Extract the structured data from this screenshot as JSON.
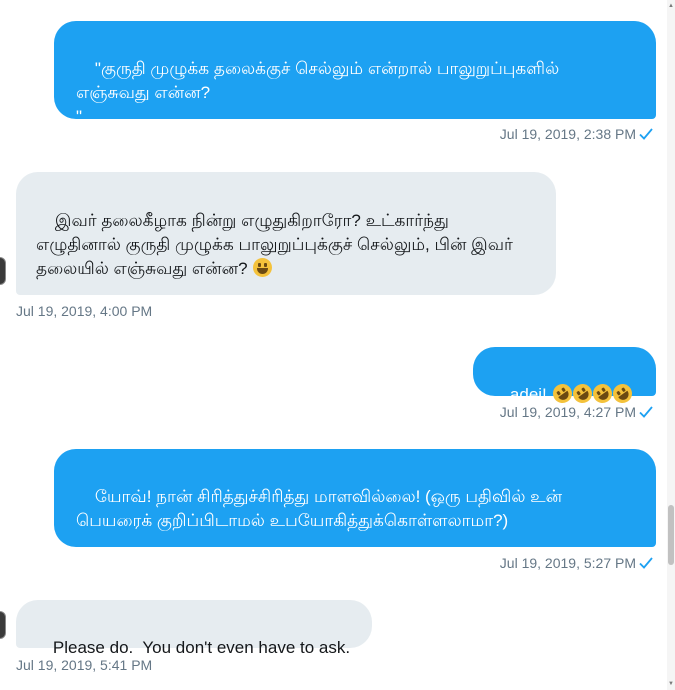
{
  "messages": [
    {
      "direction": "sent",
      "text": "\"குருதி முழுக்க தலைக்குச் செல்லும் என்றால் பாலுறுப்புகளில் எஞ்சுவது என்ன?\n\"",
      "timestamp": "Jul 19, 2019, 2:38 PM"
    },
    {
      "direction": "received",
      "text": "இவர் தலைகீழாக நின்று எழுதுகிறாரோ? உட்கார்ந்து எழுதினால் குருதி முழுக்க பாலுறுப்புக்குச் செல்லும், பின் இவர் தலையில் எஞ்சுவது என்ன?",
      "emoji": "grinning-face-emoji",
      "timestamp": "Jul 19, 2019, 4:00 PM"
    },
    {
      "direction": "sent",
      "text": "adei!",
      "emoji": "rolling-on-the-floor-laughing-emoji",
      "emoji_count": 4,
      "timestamp": "Jul 19, 2019, 4:27 PM"
    },
    {
      "direction": "sent",
      "text": "யோவ்! நான் சிரித்துச்சிரித்து மாளவில்லை! (ஒரு பதிவில் உன் பெயரைக் குறிப்பிடாமல் உபயோகித்துக்கொள்ளலாமா?)",
      "timestamp": "Jul 19, 2019, 5:27 PM"
    },
    {
      "direction": "received",
      "text": "Please do.  You don't even have to ask.",
      "timestamp": "Jul 19, 2019, 5:41 PM"
    }
  ],
  "icons": {
    "read_receipt": "checkmark-icon",
    "avatar": "user-avatar"
  },
  "colors": {
    "sent_bubble": "#1da1f2",
    "received_bubble": "#e6ecf0",
    "timestamp_text": "#657786",
    "checkmark": "#1da1f2"
  }
}
